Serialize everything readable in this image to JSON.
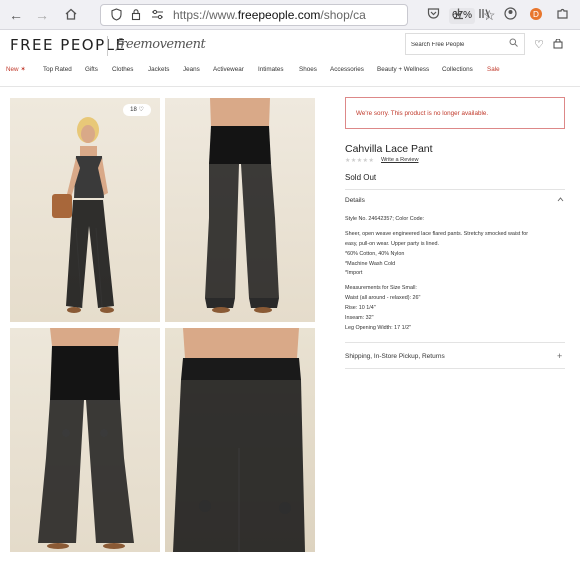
{
  "browser": {
    "url_prefix": "https://www.",
    "url_domain": "freepeople.com",
    "url_rest": "/shop/ca",
    "zoom": "67%"
  },
  "header": {
    "logo": "FREE PEOPLE",
    "sub_logo": "freemovement",
    "search_placeholder": "Search Free People"
  },
  "nav": {
    "items": [
      "New ✶",
      "Top Rated",
      "Gifts",
      "Clothes",
      "Jackets",
      "Jeans",
      "Activewear",
      "Intimates",
      "Shoes",
      "Accessories",
      "Beauty + Wellness",
      "Collections",
      "Sale"
    ]
  },
  "gallery": {
    "wishlist_count": "18"
  },
  "product": {
    "alert": "We're sorry. This product is no longer available.",
    "name": "Cahvilla Lace Pant",
    "stars": "★★★★★",
    "write_review": "Write a Review",
    "status": "Sold Out",
    "details_label": "Details",
    "style_line": "Style No. 24642357; Color Code:",
    "desc1": "Sheer, open weave engineered lace flared pants. Stretchy smocked waist for",
    "desc2": "easy, pull-on wear. Upper party is lined.",
    "fabric": "*60% Cotton, 40% Nylon",
    "care": "*Machine Wash Cold",
    "import": "*Import",
    "meas_title": "Measurements for Size Small:",
    "waist": "Waist (all around - relaxed): 26\"",
    "rise": "Rise: 10 1/4\"",
    "inseam": "Inseam: 32\"",
    "leg": "Leg Opening Width: 17 1/2\"",
    "shipping_label": "Shipping, In-Store Pickup, Returns"
  },
  "colors": {
    "alert_red": "#c0392b",
    "sale_red": "#c0392b",
    "garment_black": "#141414",
    "backdrop": "#e9e2d4"
  }
}
